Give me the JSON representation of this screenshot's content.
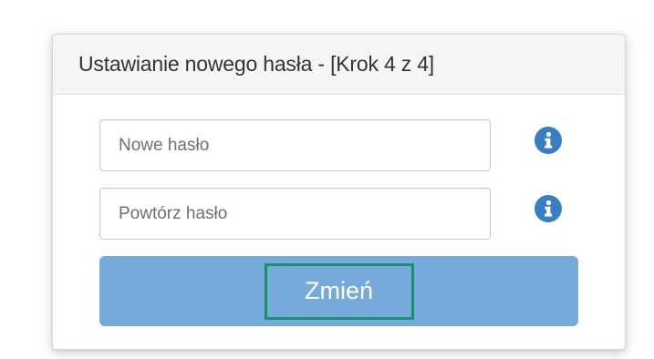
{
  "header": {
    "title": "Ustawianie nowego hasła - [Krok 4 z 4]"
  },
  "form": {
    "new_password": {
      "placeholder": "Nowe hasło",
      "value": "",
      "info_icon": "info-circle-icon"
    },
    "repeat_password": {
      "placeholder": "Powtórz hasło",
      "value": "",
      "info_icon": "info-circle-icon"
    },
    "submit_label": "Zmień"
  },
  "colors": {
    "header_bg": "#f5f5f5",
    "info_icon": "#3a7dc1",
    "button_bg": "#75aada",
    "highlight_border": "#1a8f6f"
  }
}
